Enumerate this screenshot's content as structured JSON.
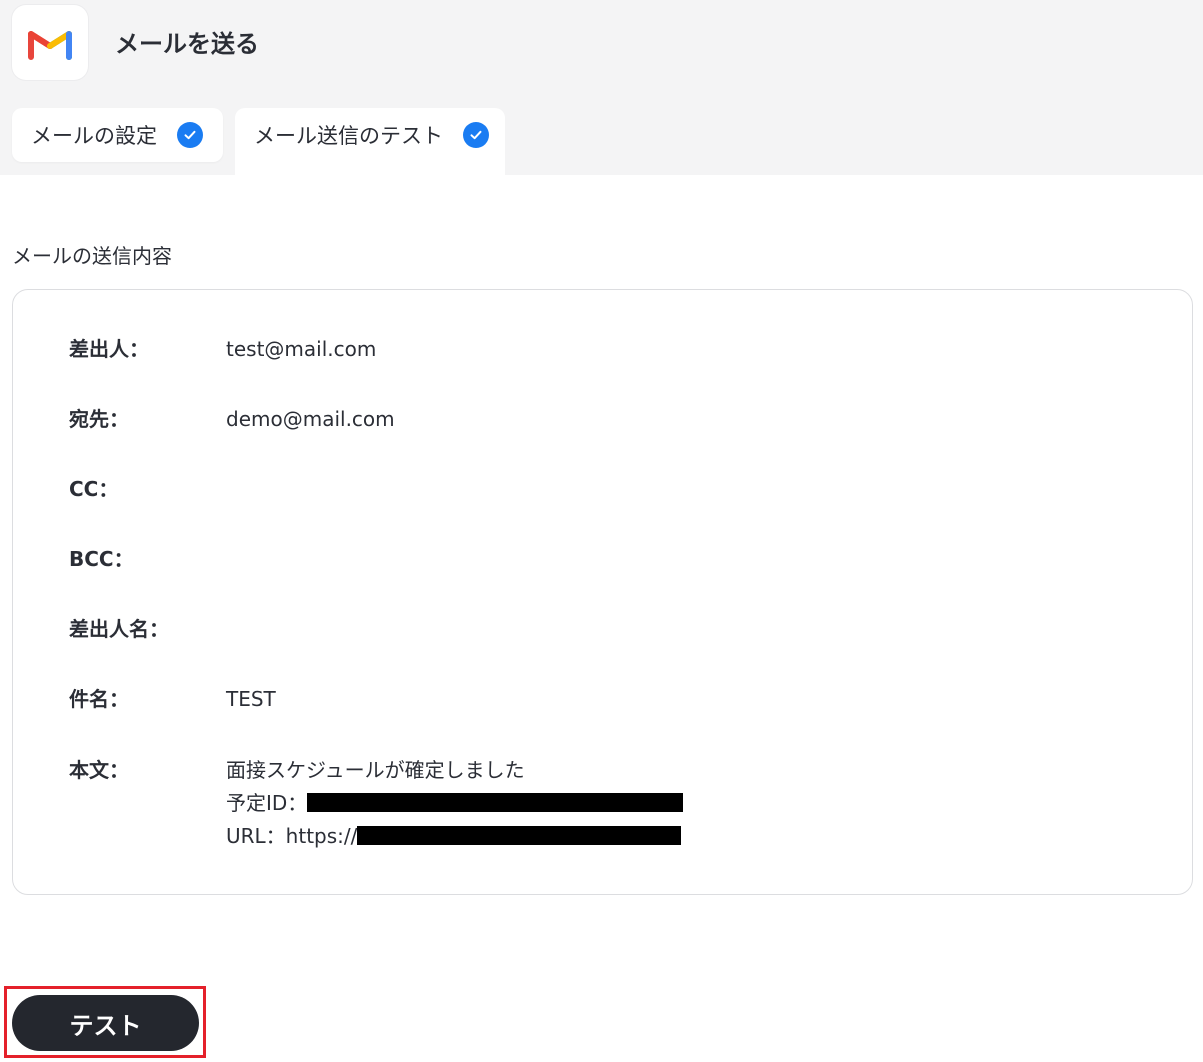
{
  "header": {
    "title": "メールを送る",
    "app_icon": "gmail-icon"
  },
  "tabs": [
    {
      "label": "メールの設定",
      "completed": true,
      "active": false
    },
    {
      "label": "メール送信のテスト",
      "completed": true,
      "active": true
    }
  ],
  "section": {
    "title": "メールの送信内容"
  },
  "fields": {
    "from": {
      "label": "差出人：",
      "value": "test@mail.com"
    },
    "to": {
      "label": "宛先：",
      "value": "demo@mail.com"
    },
    "cc": {
      "label": "CC：",
      "value": ""
    },
    "bcc": {
      "label": "BCC：",
      "value": ""
    },
    "sender_name": {
      "label": "差出人名：",
      "value": ""
    },
    "subject": {
      "label": "件名：",
      "value": "TEST"
    },
    "body": {
      "label": "本文：",
      "lines": [
        "面接スケジュールが確定しました",
        "予定ID：",
        "URL：https://"
      ]
    }
  },
  "button": {
    "label": "テスト"
  },
  "colors": {
    "check": "#1a7cf2",
    "button_bg": "#24272e",
    "highlight": "#e4202a",
    "header_bg": "#f4f4f5"
  }
}
